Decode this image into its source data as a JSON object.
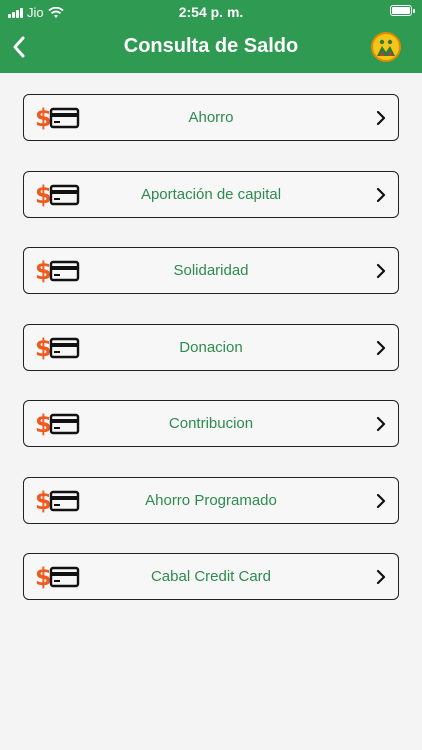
{
  "status_bar": {
    "carrier": "Jio",
    "time": "2:54 p. m."
  },
  "header": {
    "title": "Consulta de Saldo"
  },
  "menu": {
    "items": [
      {
        "label": "Ahorro"
      },
      {
        "label": "Aportación de capital"
      },
      {
        "label": "Solidaridad"
      },
      {
        "label": "Donacion"
      },
      {
        "label": "Contribucion"
      },
      {
        "label": "Ahorro Programado"
      },
      {
        "label": "Cabal Credit Card"
      }
    ]
  },
  "icons": {
    "back": "chevron-left-icon",
    "logo": "cooperative-logo-icon",
    "item": "dollar-card-icon",
    "item_arrow": "chevron-right-icon"
  },
  "colors": {
    "header_bg": "#2e9a52",
    "label_text": "#2e8b4e",
    "dollar_orange": "#f05a1e"
  }
}
